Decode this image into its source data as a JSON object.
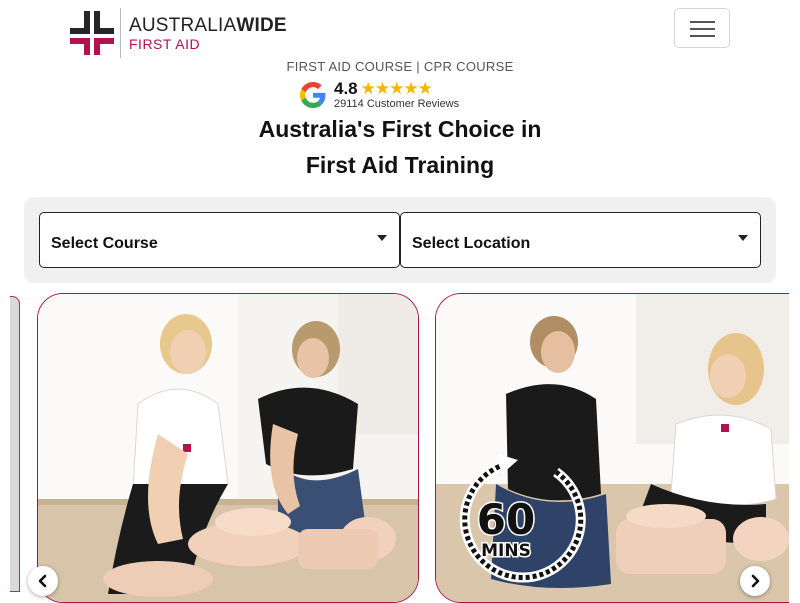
{
  "brand": {
    "name_light": "AUSTRALIA",
    "name_bold": "WIDE",
    "tagline": "FIRST AID",
    "accent_color": "#b3124f",
    "dark_color": "#262626"
  },
  "header": {
    "menu_icon": "hamburger-icon"
  },
  "subheading": "FIRST AID COURSE | CPR COURSE",
  "rating": {
    "score": "4.8",
    "stars": "★★★★★",
    "reviews": "29114 Customer Reviews",
    "icon": "google-icon"
  },
  "headline": {
    "line1": "Australia's First Choice in",
    "line2": "First Aid Training"
  },
  "search": {
    "course_select": "Select Course",
    "location_select": "Select Location"
  },
  "carousel": {
    "badge_number": "60",
    "badge_unit": "MINS",
    "prev_icon": "chevron-left-icon",
    "next_icon": "chevron-right-icon"
  }
}
